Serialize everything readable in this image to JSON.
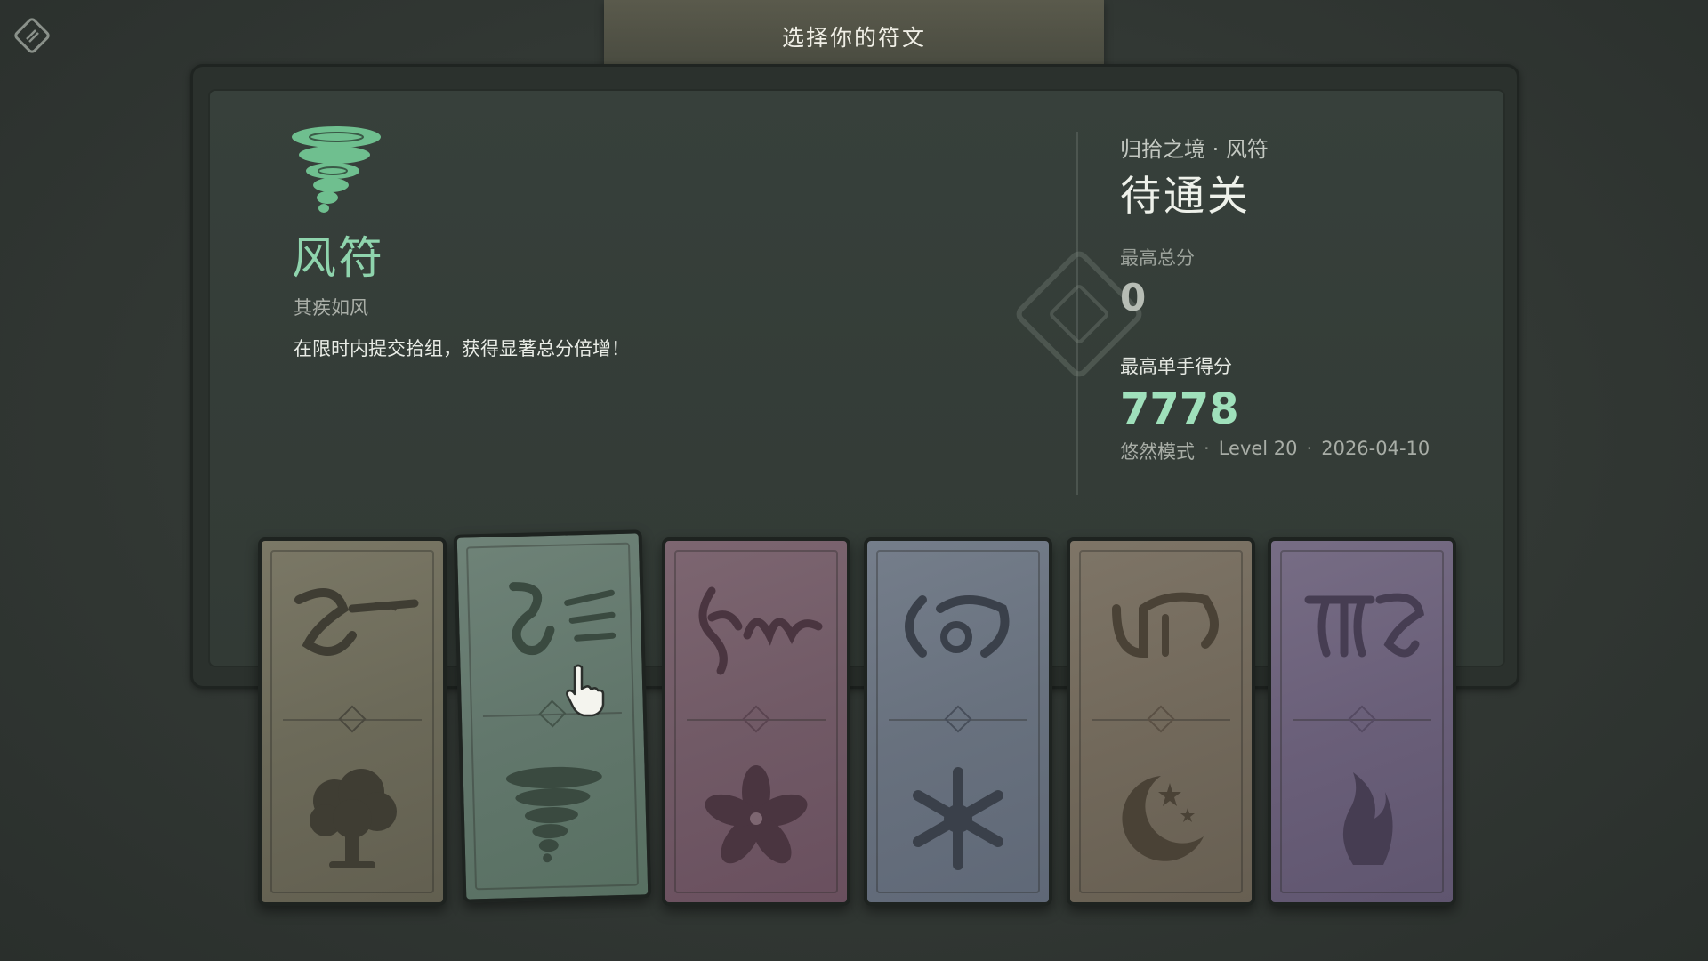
{
  "header": {
    "title": "选择你的符文"
  },
  "selected_rune": {
    "name": "风符",
    "subtitle": "其疾如风",
    "description": "在限时内提交拾组，获得显著总分倍增！",
    "icon": "tornado-icon",
    "color": "#8fd4ad"
  },
  "stats": {
    "stage": "归拾之境 · 风符",
    "status": "待通关",
    "best_total_label": "最高总分",
    "best_total_value": "0",
    "best_hand_label": "最高单手得分",
    "best_hand_value": "7778",
    "meta": {
      "mode": "悠然模式",
      "level": "Level 20",
      "date": "2026-04-10"
    }
  },
  "cards": [
    {
      "id": "tree",
      "symbol": "tree-icon",
      "color": "#7b7866",
      "selected": false
    },
    {
      "id": "wind",
      "symbol": "tornado-icon",
      "color": "#6f8378",
      "selected": true
    },
    {
      "id": "flower",
      "symbol": "flower-icon",
      "color": "#7d6671",
      "selected": false
    },
    {
      "id": "snow",
      "symbol": "snowflake-icon",
      "color": "#757e8b",
      "selected": false
    },
    {
      "id": "moon",
      "symbol": "moon-star-icon",
      "color": "#7e7567",
      "selected": false
    },
    {
      "id": "flame",
      "symbol": "flame-icon",
      "color": "#776d85",
      "selected": false
    }
  ]
}
